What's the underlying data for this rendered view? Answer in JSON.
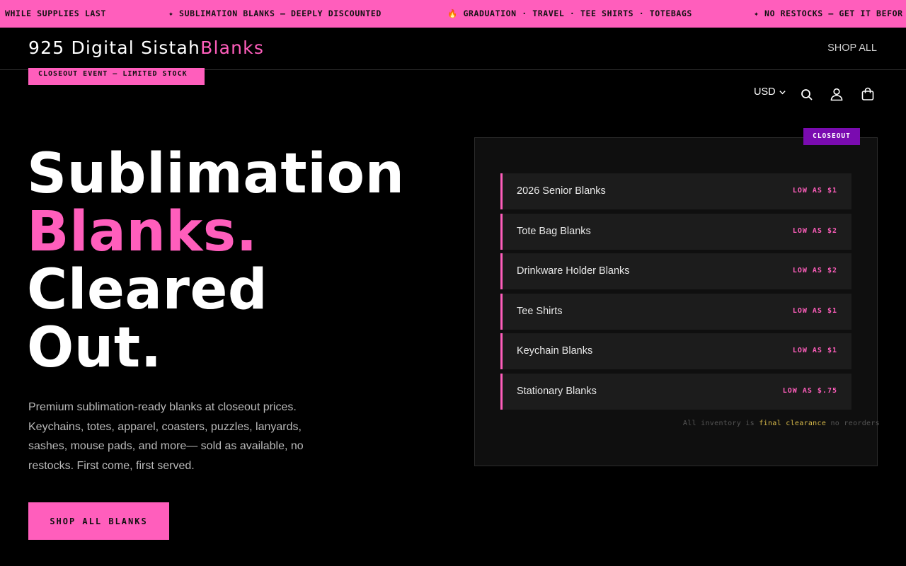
{
  "ticker": {
    "items": [
      "WHILE SUPPLIES LAST",
      "✦ SUBLIMATION BLANKS — DEEPLY DISCOUNTED",
      "🔥 GRADUATION · TRAVEL · TEE SHIRTS · TOTEBAGS",
      "✦ NO RESTOCKS — GET IT BEFOR"
    ]
  },
  "header": {
    "logo_main": "925 Digital Sistah",
    "logo_accent": "Blanks",
    "shop_all_label": "SHOP ALL"
  },
  "closeout_tag": "CLOSEOUT EVENT — LIMITED STOCK",
  "utility": {
    "currency": "USD",
    "icons": [
      "chevron-down-icon",
      "search-icon",
      "account-icon",
      "cart-icon"
    ]
  },
  "hero": {
    "title_line1": "Sublimation",
    "title_line2": "Blanks.",
    "title_line3": "Cleared",
    "title_line4": "Out.",
    "description": "Premium sublimation-ready blanks at closeout prices. Keychains, totes, apparel, coasters, puzzles, lanyards, sashes, mouse pads, and more— sold as available, no restocks. First come, first served.",
    "cta_label": "SHOP ALL BLANKS"
  },
  "panel": {
    "badge": "CLOSEOUT",
    "items": [
      {
        "name": "2026 Senior Blanks",
        "price": "LOW AS $1"
      },
      {
        "name": "Tote Bag Blanks",
        "price": "LOW AS $2"
      },
      {
        "name": "Drinkware Holder Blanks",
        "price": "LOW AS $2"
      },
      {
        "name": "Tee Shirts",
        "price": "LOW AS $1"
      },
      {
        "name": "Keychain Blanks",
        "price": "LOW AS $1"
      },
      {
        "name": "Stationary Blanks",
        "price": "LOW AS $.75"
      }
    ],
    "note_before": "All inventory is ",
    "note_highlight": "final clearance",
    "note_after": " no reorders"
  },
  "colors": {
    "accent_pink": "#ff5ebc",
    "badge_purple": "#7a0bb0",
    "highlight_gold": "#d7b94a",
    "background": "#000000",
    "panel_bg": "#0f0f0f",
    "row_bg": "#1c1c1c"
  }
}
